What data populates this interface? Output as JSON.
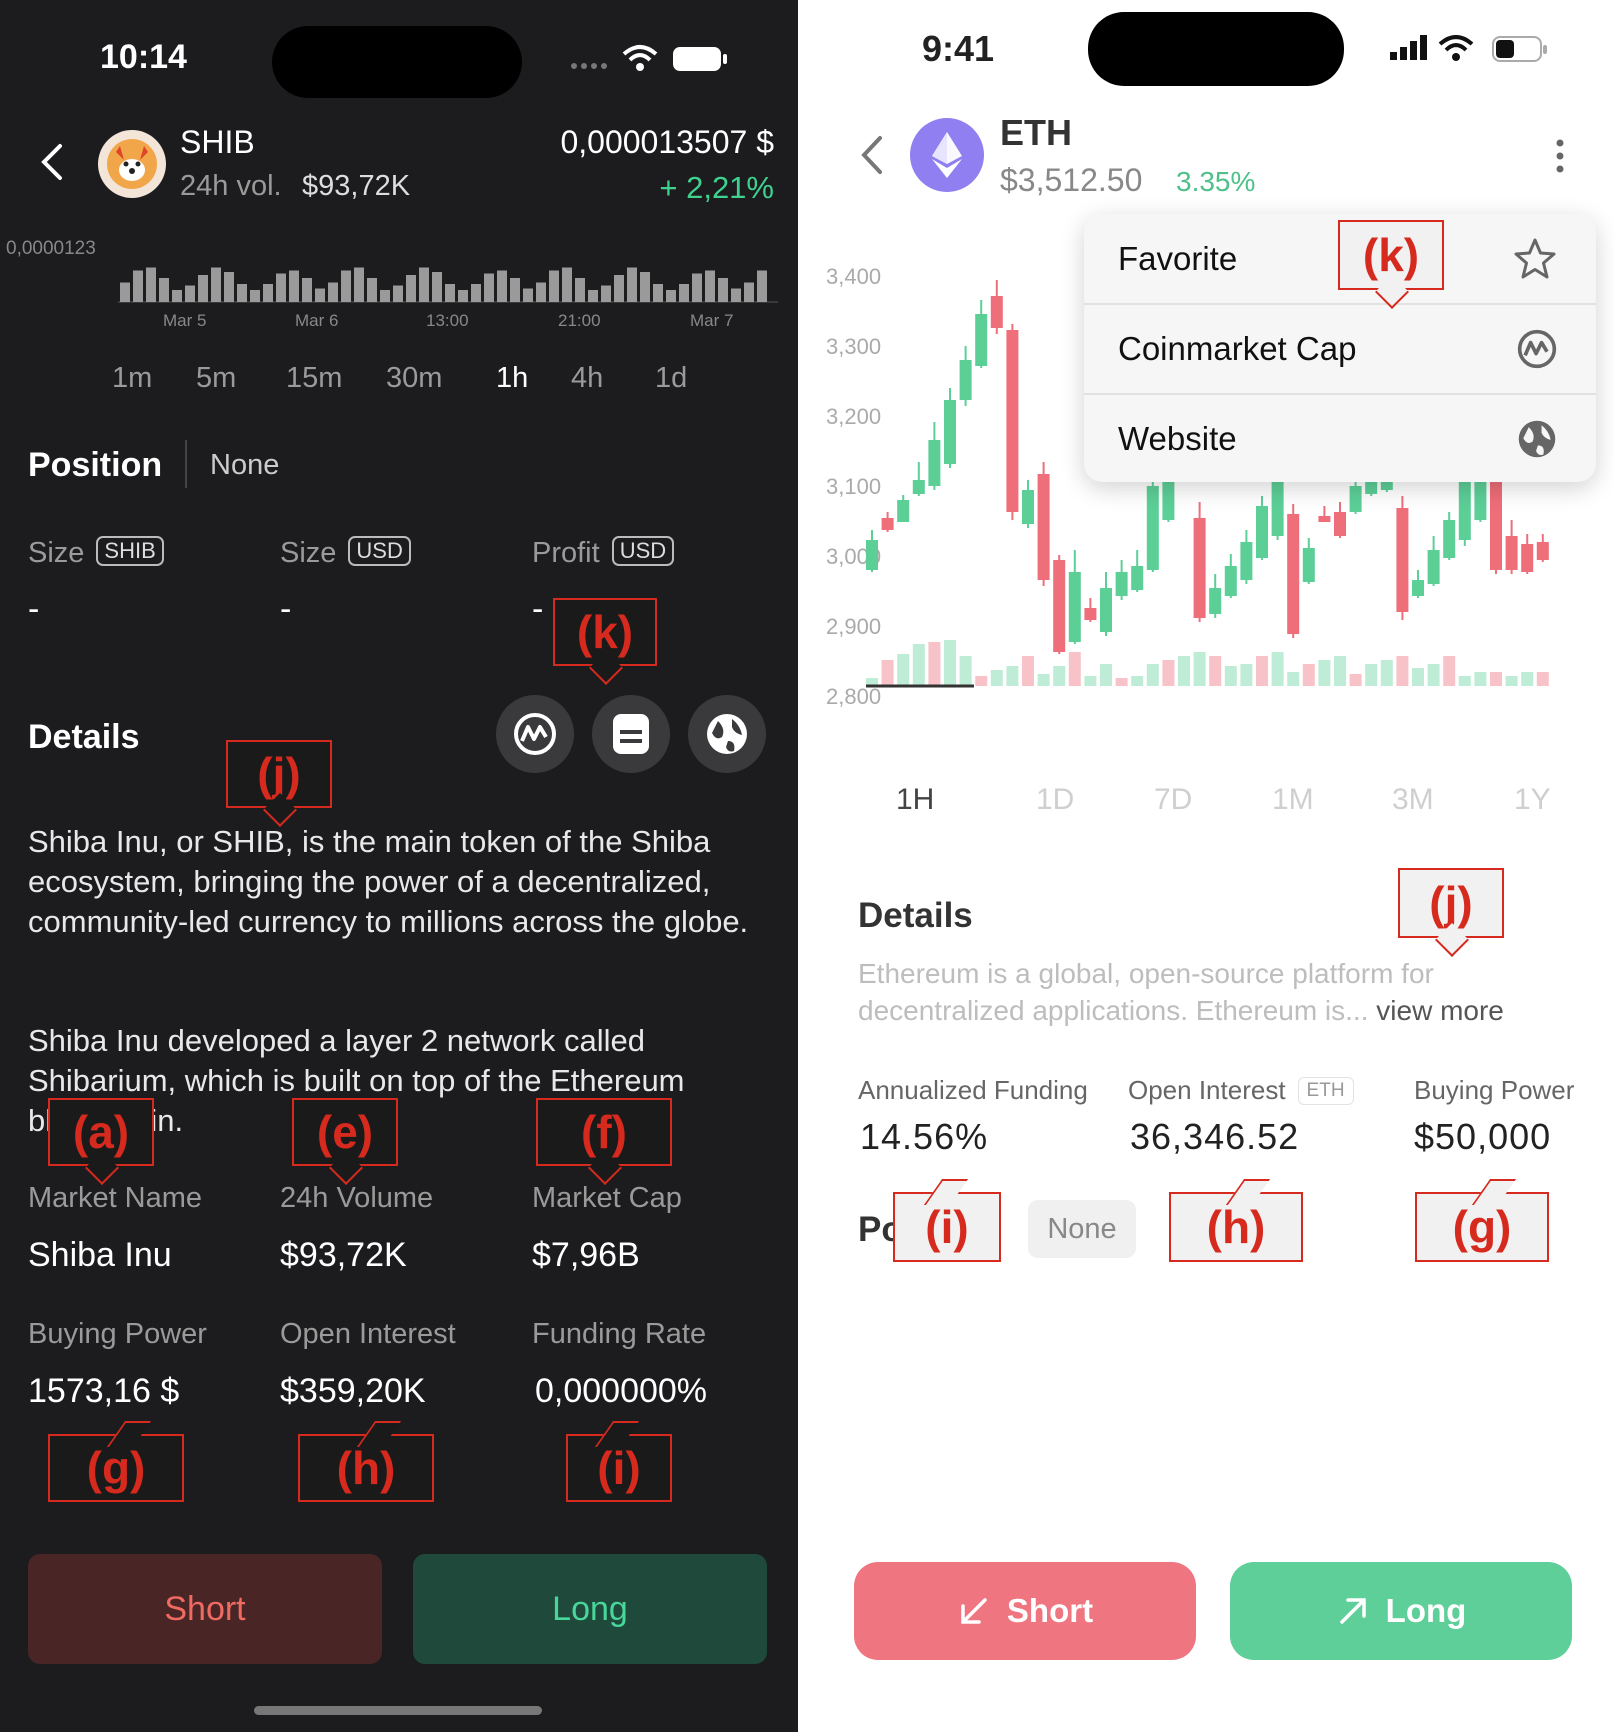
{
  "left": {
    "status": {
      "time": "10:14"
    },
    "header": {
      "symbol": "SHIB",
      "volume_label": "24h vol.",
      "volume_value": "$93,72K",
      "price": "0,000013507 $",
      "change": "+ 2,21%"
    },
    "chart": {
      "y_label": "0,0000123",
      "x_labels": [
        "Mar 5",
        "Mar 6",
        "13:00",
        "21:00",
        "Mar 7"
      ]
    },
    "timeframes": [
      "1m",
      "5m",
      "15m",
      "30m",
      "1h",
      "4h",
      "1d"
    ],
    "timeframe_selected": "1h",
    "position": {
      "title": "Position",
      "value": "None"
    },
    "sizes": [
      {
        "label": "Size",
        "unit": "SHIB",
        "value": "-"
      },
      {
        "label": "Size",
        "unit": "USD",
        "value": "-"
      },
      {
        "label": "Profit",
        "unit": "USD",
        "value": "-"
      }
    ],
    "details": {
      "title": "Details",
      "paragraph1": "Shiba Inu, or SHIB, is the main token of the Shiba ecosystem, bringing the power of a decentralized, community-led currency to millions across the globe.",
      "paragraph2": "Shiba Inu developed a layer 2 network called Shibarium, which is built on top of the Ethereum blockchain."
    },
    "stats_row1": [
      {
        "label": "Market Name",
        "value": "Shiba Inu"
      },
      {
        "label": "24h Volume",
        "value": "$93,72K"
      },
      {
        "label": "Market Cap",
        "value": "$7,96B"
      }
    ],
    "stats_row2": [
      {
        "label": "Buying Power",
        "value": "1573,16 $"
      },
      {
        "label": "Open Interest",
        "value": "$359,20K"
      },
      {
        "label": "Funding Rate",
        "value": "0,000000%"
      }
    ],
    "buttons": {
      "short": "Short",
      "long": "Long"
    },
    "annotations": {
      "k": "(k)",
      "j": "(j)",
      "a": "(a)",
      "e": "(e)",
      "f": "(f)",
      "g": "(g)",
      "h": "(h)",
      "i": "(i)"
    }
  },
  "right": {
    "status": {
      "time": "9:41"
    },
    "header": {
      "symbol": "ETH",
      "price": "$3,512.50",
      "change": "3.35%"
    },
    "menu": [
      {
        "label": "Favorite",
        "icon": "star-icon"
      },
      {
        "label": "Coinmarket Cap",
        "icon": "coinmarketcap-icon"
      },
      {
        "label": "Website",
        "icon": "globe-icon"
      }
    ],
    "chart": {
      "y_ticks": [
        "3,400",
        "3,300",
        "3,200",
        "3,100",
        "3,000",
        "2,900",
        "2,800"
      ]
    },
    "timeframes": [
      "1H",
      "1D",
      "7D",
      "1M",
      "3M",
      "1Y"
    ],
    "timeframe_selected": "1H",
    "details": {
      "title": "Details",
      "text_line1": "Ethereum is a global, open-source platform for",
      "text_line2": "decentralized applications. Ethereum is...",
      "view_more": "view more"
    },
    "stats": [
      {
        "label": "Annualized Funding",
        "value": "14.56%"
      },
      {
        "label": "Open Interest",
        "unit": "ETH",
        "value": "36,346.52"
      },
      {
        "label": "Buying Power",
        "value": "$50,000"
      }
    ],
    "position": {
      "title_partial": "Po",
      "value": "None"
    },
    "buttons": {
      "short": "Short",
      "long": "Long"
    },
    "annotations": {
      "k": "(k)",
      "j": "(j)",
      "i": "(i)",
      "h": "(h)",
      "g": "(g)"
    }
  },
  "colors": {
    "green": "#5ccf97",
    "red": "#ee6e7a",
    "dark_bg": "#1c1c1e",
    "annotation": "#d62a1e"
  }
}
